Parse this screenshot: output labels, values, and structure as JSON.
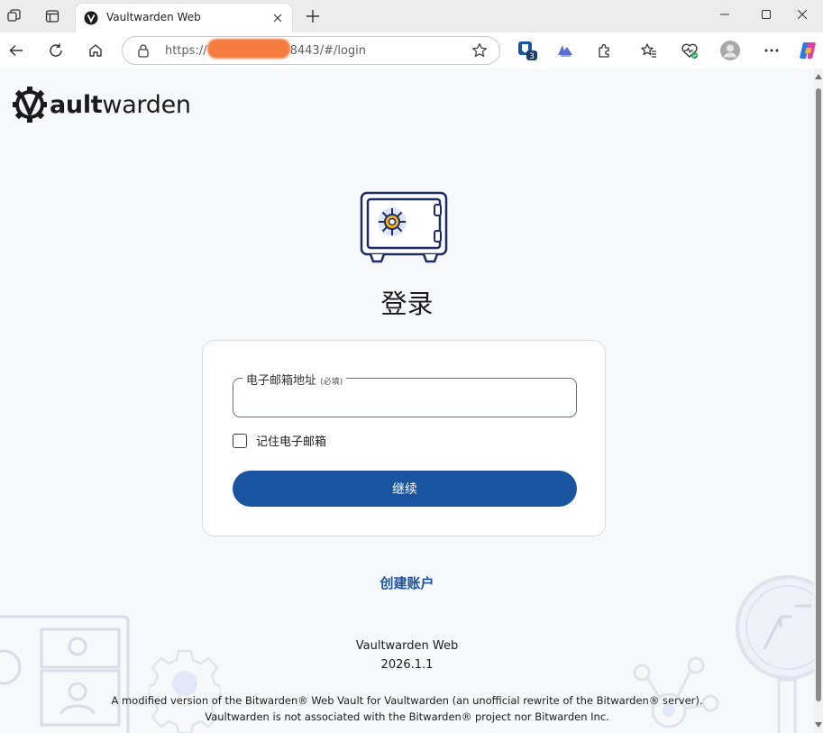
{
  "browser": {
    "tab_title": "Vaultwarden Web",
    "url_prefix": "https://",
    "url_suffix": "8443/#/login",
    "extension_badge": "3"
  },
  "page": {
    "logo_bold": "Vault",
    "logo_bold_letters": "ault",
    "logo_light": "warden",
    "heading": "登录",
    "email_label": "电子邮箱地址",
    "email_required": "(必填)",
    "email_value": "",
    "remember_label": "记住电子邮箱",
    "continue_label": "继续",
    "create_account": "创建账户",
    "footer_name": "Vaultwarden Web",
    "footer_version": "2026.1.1",
    "notice_line1": "A modified version of the Bitwarden® Web Vault for Vaultwarden (an unofficial rewrite of the Bitwarden® server).",
    "notice_line2": "Vaultwarden is not associated with the Bitwarden® project nor Bitwarden Inc."
  },
  "colors": {
    "accent": "#1a54a0",
    "redaction": "#f57b3f"
  }
}
